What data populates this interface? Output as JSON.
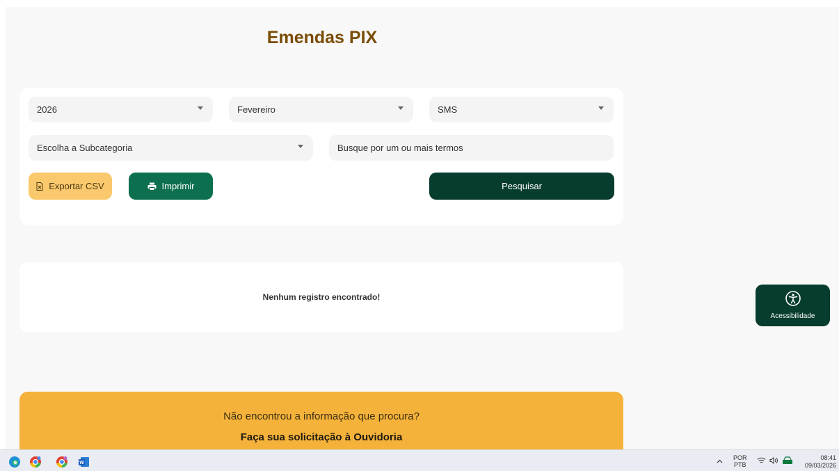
{
  "page": {
    "title": "Emendas PIX"
  },
  "filters": {
    "year": "2026",
    "month": "Fevereiro",
    "category": "SMS",
    "subcategory": "Escolha a Subcategoria",
    "search_placeholder": "Busque por um ou mais termos",
    "export_label": "Exportar CSV",
    "print_label": "Imprimir",
    "search_button": "Pesquisar"
  },
  "results": {
    "empty_message": "Nenhum registro encontrado!"
  },
  "ouvidoria": {
    "question": "Não encontrou a informação que procura?",
    "cta": "Faça sua solicitação à Ouvidoria"
  },
  "accessibility": {
    "label": "Acessibilidade",
    "icon": "accessibility-icon"
  },
  "taskbar": {
    "apps": [
      "edge-icon",
      "chrome-icon",
      "chrome-profile-icon",
      "word-icon"
    ],
    "lang_top": "POR",
    "lang_bottom": "PTB",
    "time": "08:41",
    "date": "09/03/2026"
  },
  "colors": {
    "title": "#7a4c05",
    "primary_dark": "#073d2e",
    "primary": "#0c6f4f",
    "warning": "#fbc96d",
    "ouvidoria_bg": "#f5b23a"
  }
}
